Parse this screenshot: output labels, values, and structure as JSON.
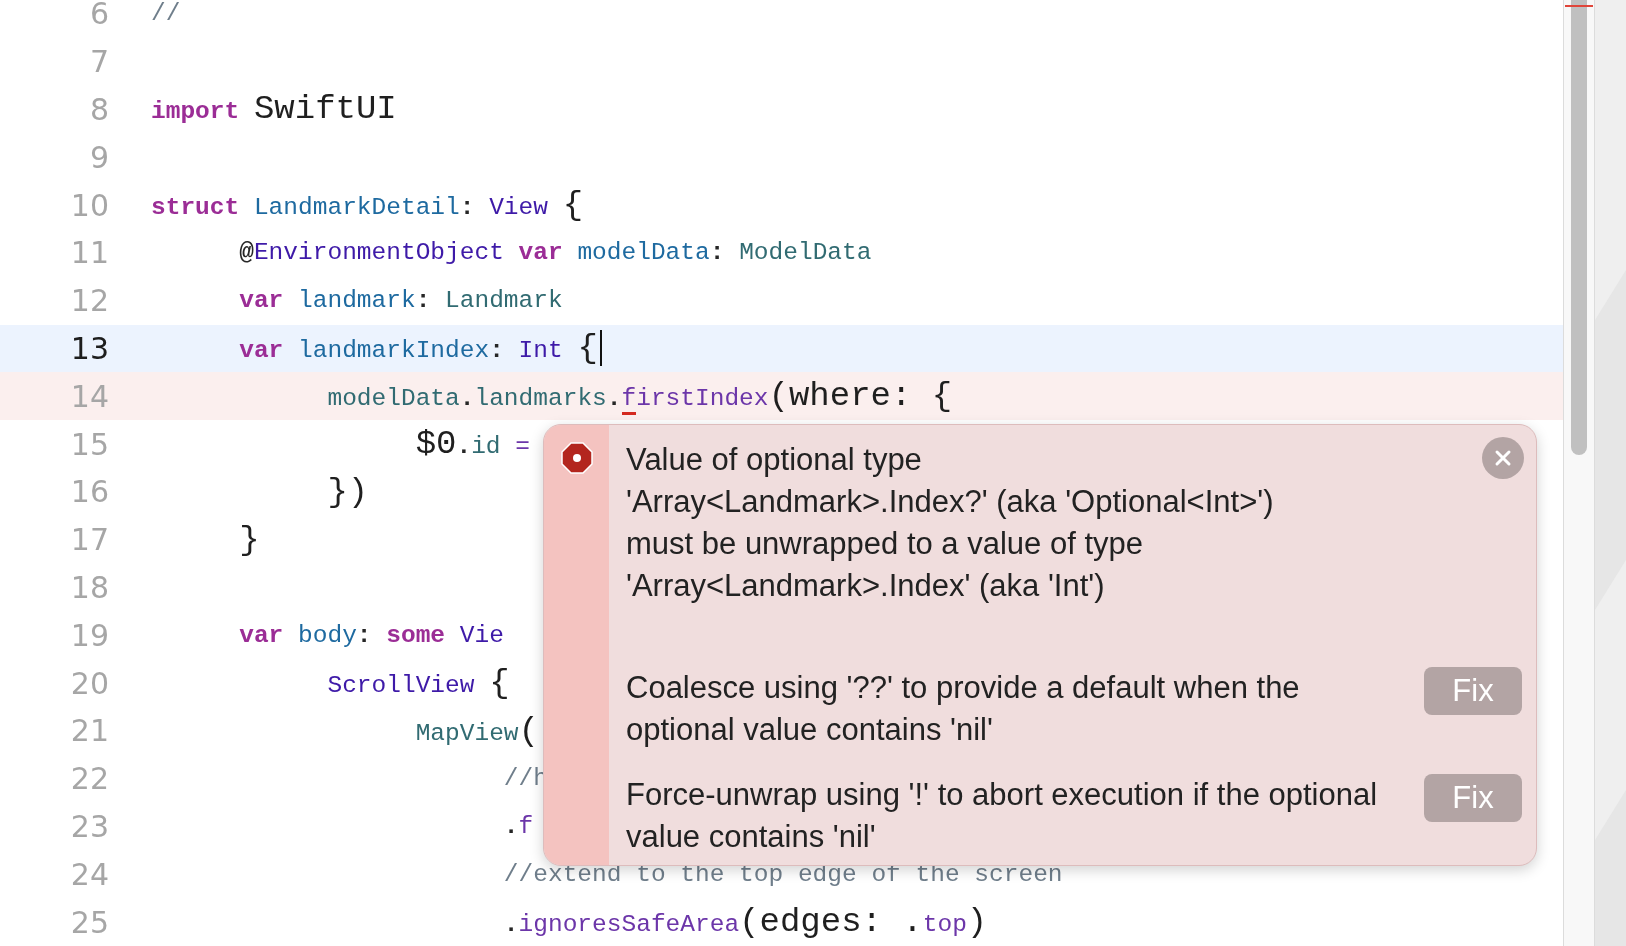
{
  "editor": {
    "lines": [
      {
        "number": "6",
        "current": false,
        "error": false,
        "tokens": [
          {
            "text": "//",
            "kind": "comment"
          }
        ]
      },
      {
        "number": "7",
        "current": false,
        "error": false
      },
      {
        "number": "8",
        "current": false,
        "error": false,
        "tokens": [
          {
            "text": "import",
            "kind": "keyword"
          },
          {
            "text": " SwiftUI",
            "kind": "large"
          }
        ]
      },
      {
        "number": "9",
        "current": false,
        "error": false
      },
      {
        "number": "10",
        "current": false,
        "error": false,
        "tokens": [
          {
            "text": "struct",
            "kind": "keyword"
          },
          {
            "text": " LandmarkDetail",
            "kind": "decl"
          },
          {
            "text": ":",
            "kind": "plain"
          },
          {
            "text": " View",
            "kind": "type"
          },
          {
            "text": " {",
            "kind": "large"
          }
        ]
      },
      {
        "number": "11",
        "current": false,
        "error": false,
        "tokens": [
          {
            "text": "      @",
            "kind": "plain"
          },
          {
            "text": "EnvironmentObject",
            "kind": "type"
          },
          {
            "text": " var",
            "kind": "keyword"
          },
          {
            "text": " modelData",
            "kind": "decl"
          },
          {
            "text": ":",
            "kind": "plain"
          },
          {
            "text": " ModelData",
            "kind": "ident"
          }
        ]
      },
      {
        "number": "12",
        "current": false,
        "error": false,
        "tokens": [
          {
            "text": "      var",
            "kind": "keyword"
          },
          {
            "text": " landmark",
            "kind": "decl"
          },
          {
            "text": ":",
            "kind": "plain"
          },
          {
            "text": " Landmark",
            "kind": "ident"
          }
        ]
      },
      {
        "number": "13",
        "current": true,
        "error": false,
        "tokens": [
          {
            "text": "      var",
            "kind": "keyword"
          },
          {
            "text": " landmarkIndex",
            "kind": "decl"
          },
          {
            "text": ":",
            "kind": "plain"
          },
          {
            "text": " Int",
            "kind": "type"
          },
          {
            "text": " {",
            "kind": "large"
          }
        ]
      },
      {
        "number": "14",
        "current": false,
        "error": true,
        "tokens": [
          {
            "text": "            modelData",
            "kind": "ident"
          },
          {
            "text": ".",
            "kind": "plain"
          },
          {
            "text": "landmarks",
            "kind": "ident"
          },
          {
            "text": ".",
            "kind": "plain"
          },
          {
            "text": "firstIndex",
            "kind": "member",
            "flagged": true
          },
          {
            "text": "(where: {",
            "kind": "large"
          }
        ]
      },
      {
        "number": "15",
        "current": false,
        "error": false,
        "tokens": [
          {
            "text": "                  $0",
            "kind": "large"
          },
          {
            "text": ".",
            "kind": "plain"
          },
          {
            "text": "id",
            "kind": "ident"
          },
          {
            "text": " =",
            "kind": "member"
          }
        ]
      },
      {
        "number": "16",
        "current": false,
        "error": false,
        "tokens": [
          {
            "text": "            })",
            "kind": "large"
          }
        ]
      },
      {
        "number": "17",
        "current": false,
        "error": false,
        "tokens": [
          {
            "text": "      }",
            "kind": "large"
          }
        ]
      },
      {
        "number": "18",
        "current": false,
        "error": false
      },
      {
        "number": "19",
        "current": false,
        "error": false,
        "tokens": [
          {
            "text": "      var",
            "kind": "keyword"
          },
          {
            "text": " body",
            "kind": "decl"
          },
          {
            "text": ":",
            "kind": "plain"
          },
          {
            "text": " some",
            "kind": "keyword"
          },
          {
            "text": " Vie",
            "kind": "type"
          }
        ]
      },
      {
        "number": "20",
        "current": false,
        "error": false,
        "tokens": [
          {
            "text": "            ScrollView",
            "kind": "type"
          },
          {
            "text": " {",
            "kind": "large"
          }
        ]
      },
      {
        "number": "21",
        "current": false,
        "error": false,
        "tokens": [
          {
            "text": "                  MapView",
            "kind": "ident"
          },
          {
            "text": "(",
            "kind": "large"
          }
        ]
      },
      {
        "number": "22",
        "current": false,
        "error": false,
        "tokens": [
          {
            "text": "                        //h",
            "kind": "comment"
          }
        ]
      },
      {
        "number": "23",
        "current": false,
        "error": false,
        "tokens": [
          {
            "text": "                        .",
            "kind": "plain"
          },
          {
            "text": "f",
            "kind": "member"
          }
        ]
      },
      {
        "number": "24",
        "current": false,
        "error": false,
        "tokens": [
          {
            "text": "                        //extend to the top edge of the screen",
            "kind": "comment"
          }
        ]
      },
      {
        "number": "25",
        "current": false,
        "error": false,
        "tokens": [
          {
            "text": "                        .",
            "kind": "plain"
          },
          {
            "text": "ignoresSafeArea",
            "kind": "member"
          },
          {
            "text": "(edges: .",
            "kind": "large"
          },
          {
            "text": "top",
            "kind": "member"
          },
          {
            "text": ")",
            "kind": "large"
          }
        ]
      }
    ]
  },
  "issue_popup": {
    "message": "Value of optional type\n'Array<Landmark>.Index?' (aka 'Optional<Int>')\nmust be unwrapped to a value of type\n'Array<Landmark>.Index' (aka 'Int')",
    "fixes": [
      {
        "text": "Coalesce using '??' to provide a default when the optional value contains 'nil'",
        "button": "Fix"
      },
      {
        "text": "Force-unwrap using '!' to abort execution if the optional value contains 'nil'",
        "button": "Fix"
      }
    ]
  }
}
